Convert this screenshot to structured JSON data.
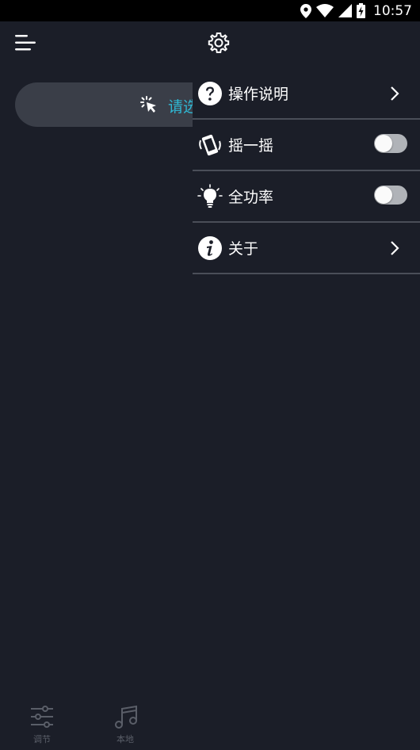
{
  "status_bar": {
    "time": "10:57"
  },
  "header": {
    "menu_icon": "menu-icon",
    "settings_icon": "gear-icon"
  },
  "connect_pill": {
    "text": "请选择设备",
    "icon": "click-icon",
    "accent": "#2fb8d4"
  },
  "drawer": {
    "items": [
      {
        "label": "操作说明",
        "icon": "help-icon",
        "control": "chevron"
      },
      {
        "label": "摇一摇",
        "icon": "shake-phone-icon",
        "control": "toggle",
        "on": false
      },
      {
        "label": "全功率",
        "icon": "lightbulb-icon",
        "control": "toggle",
        "on": false
      },
      {
        "label": "关于",
        "icon": "info-icon",
        "control": "chevron"
      }
    ]
  },
  "bottom_nav": {
    "items": [
      {
        "label": "调节",
        "icon": "sliders-icon"
      },
      {
        "label": "本地",
        "icon": "music-note-icon"
      }
    ]
  },
  "colors": {
    "background": "#1b1e28",
    "divider": "#4a4e58",
    "accent": "#2fb8d4"
  }
}
